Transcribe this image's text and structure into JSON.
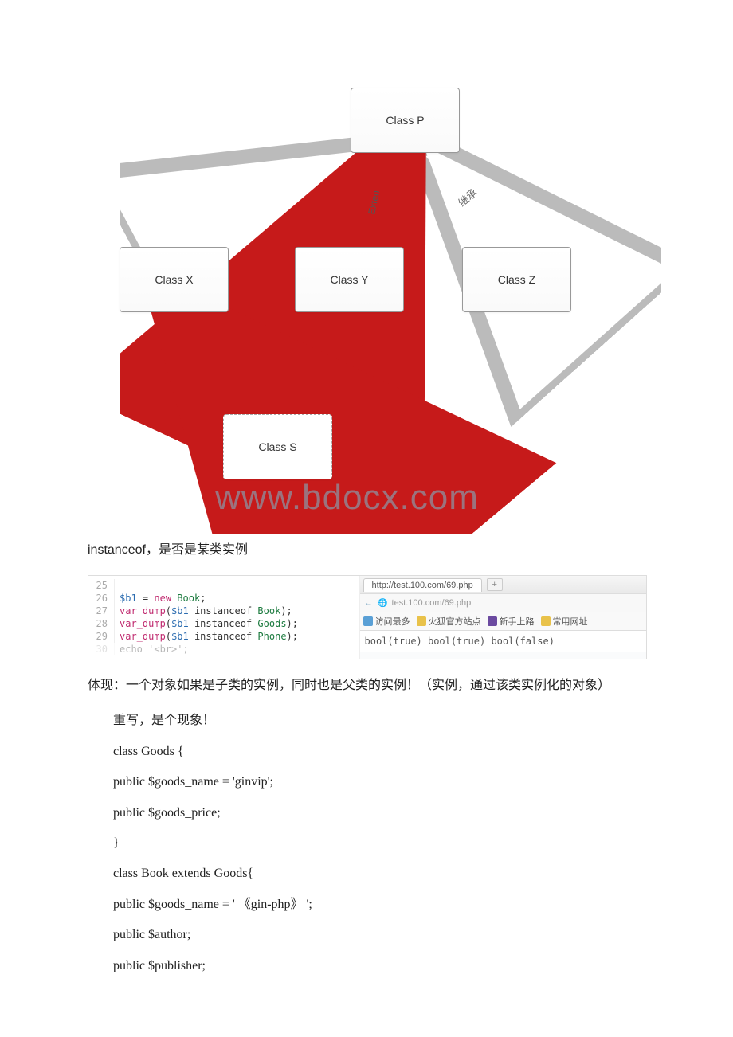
{
  "diagram": {
    "nodes": {
      "p": "Class P",
      "x": "Class X",
      "y": "Class Y",
      "z": "Class Z",
      "s": "Class S"
    },
    "arrow_labels": {
      "extend": "Exten",
      "inherit": "继承"
    },
    "watermark": "www.bdocx.com"
  },
  "caption_instanceof": "instanceof，是否是某类实例",
  "code_editor": {
    "lines": [
      {
        "ln": "25",
        "text": ""
      },
      {
        "ln": "26",
        "tokens": [
          [
            "var",
            "$b1"
          ],
          [
            "pl",
            " = "
          ],
          [
            "kw",
            "new"
          ],
          [
            "pl",
            " "
          ],
          [
            "id",
            "Book"
          ],
          [
            "pl",
            ";"
          ]
        ]
      },
      {
        "ln": "27",
        "tokens": [
          [
            "fn",
            "var_dump"
          ],
          [
            "pl",
            "("
          ],
          [
            "var",
            "$b1"
          ],
          [
            "pl",
            " instanceof "
          ],
          [
            "id",
            "Book"
          ],
          [
            "pl",
            ");"
          ]
        ]
      },
      {
        "ln": "28",
        "tokens": [
          [
            "fn",
            "var_dump"
          ],
          [
            "pl",
            "("
          ],
          [
            "var",
            "$b1"
          ],
          [
            "pl",
            " instanceof "
          ],
          [
            "id",
            "Goods"
          ],
          [
            "pl",
            ");"
          ]
        ]
      },
      {
        "ln": "29",
        "tokens": [
          [
            "fn",
            "var_dump"
          ],
          [
            "pl",
            "("
          ],
          [
            "var",
            "$b1"
          ],
          [
            "pl",
            " instanceof "
          ],
          [
            "id",
            "Phone"
          ],
          [
            "pl",
            ");"
          ]
        ]
      },
      {
        "ln": "30",
        "tokens": [
          [
            "pl",
            "echo '<br>';"
          ]
        ],
        "dim": true
      }
    ]
  },
  "browser": {
    "tab_title": "http://test.100.com/69.php",
    "address": "test.100.com/69.php",
    "bookmarks": [
      {
        "icon": "blue",
        "label": "访问最多"
      },
      {
        "icon": "yellow",
        "label": "火狐官方站点"
      },
      {
        "icon": "purple",
        "label": "新手上路"
      },
      {
        "icon": "yellow2",
        "label": "常用网址"
      }
    ],
    "output": "bool(true) bool(true) bool(false)"
  },
  "body_text": {
    "p1": "体现：一个对象如果是子类的实例，同时也是父类的实例！（实例，通过该类实例化的对象）",
    "p2": "重写，是个现象！",
    "c1": "class Goods {",
    "c2": " public $goods_name = 'ginvip';",
    "c3": " public $goods_price;",
    "c4": "}",
    "c5": "class Book extends Goods{",
    "c6": " public $goods_name = ' 《gin-php》 ';",
    "c7": " public $author;",
    "c8": " public $publisher;"
  }
}
